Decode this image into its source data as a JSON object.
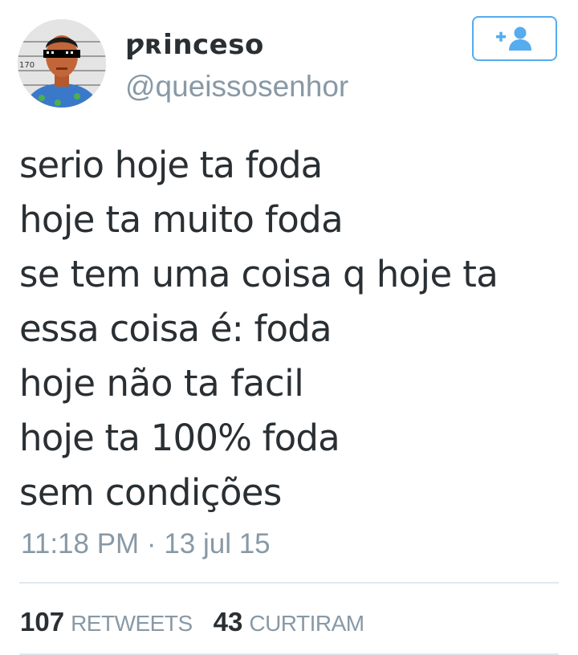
{
  "tweet": {
    "author": {
      "display_name": "ƿʀinceso",
      "handle": "@queissosenhor",
      "avatar_height_marker": "170"
    },
    "follow_button": {
      "icon": "add-user-icon",
      "color": "#55acee"
    },
    "text_lines": [
      "serio hoje ta foda",
      "hoje ta muito foda",
      "se tem uma coisa q hoje ta",
      "essa coisa é: foda",
      "hoje não ta facil",
      "hoje ta 100% foda",
      "sem condições"
    ],
    "timestamp": "11:18 PM · 13 jul 15",
    "stats": {
      "retweets_count": "107",
      "retweets_label": "RETWEETS",
      "likes_count": "43",
      "likes_label": "CURTIRAM"
    }
  },
  "colors": {
    "text": "#292f33",
    "muted": "#8899a6",
    "accent": "#55acee",
    "divider": "#e1e8ed"
  }
}
